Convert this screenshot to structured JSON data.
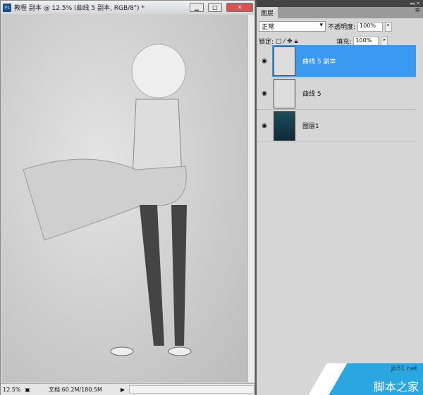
{
  "document": {
    "title": "教程 副本 @ 12.5% (曲线 5 副本, RGB/8\") *",
    "app_icon": "Ps",
    "zoom": "12.5%",
    "doc_size": "文档:60.2M/180.5M"
  },
  "panel": {
    "tab": "图层",
    "blend_mode": "正常",
    "opacity_label": "不透明度:",
    "opacity": "100%",
    "lock_label": "锁定:",
    "fill_label": "填充:",
    "fill": "100%",
    "layers": [
      {
        "name": "曲线 5 副本",
        "selected": true
      },
      {
        "name": "曲线 5",
        "selected": false
      },
      {
        "name": "图层1",
        "selected": false
      }
    ]
  },
  "watermark": {
    "site": "jb51.net",
    "text": "脚本之家"
  },
  "colors": {
    "selection": "#3a99f0"
  }
}
